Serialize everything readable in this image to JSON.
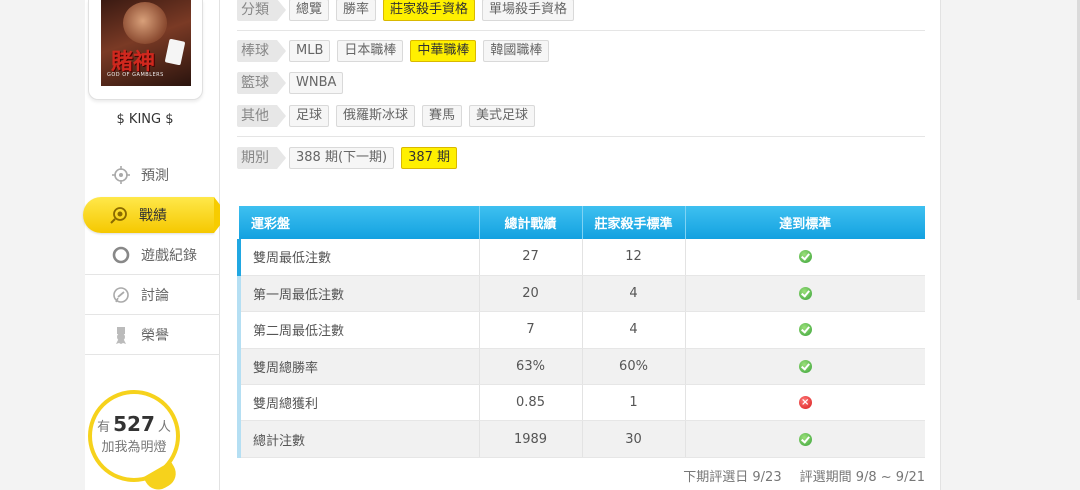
{
  "user": {
    "avatar_title": "賭神",
    "avatar_subtitle": "GOD OF GAMBLERS",
    "name": "$ KING $"
  },
  "nav": [
    {
      "label": "預測",
      "icon": "crosshair-icon",
      "active": false
    },
    {
      "label": "戰績",
      "icon": "chart-icon",
      "active": true
    },
    {
      "label": "遊戲紀錄",
      "icon": "record-icon",
      "active": false
    },
    {
      "label": "討論",
      "icon": "chat-icon",
      "active": false
    },
    {
      "label": "榮譽",
      "icon": "medal-icon",
      "active": false
    }
  ],
  "fans": {
    "prefix": "有",
    "count": "527",
    "suffix": "人",
    "caption": "加我為明燈"
  },
  "filters": {
    "category": {
      "label": "分類",
      "options": [
        "總覽",
        "勝率",
        "莊家殺手資格",
        "單場殺手資格"
      ],
      "selected": "莊家殺手資格"
    },
    "baseball": {
      "label": "棒球",
      "options": [
        "MLB",
        "日本職棒",
        "中華職棒",
        "韓國職棒"
      ],
      "selected": "中華職棒"
    },
    "basketball": {
      "label": "籃球",
      "options": [
        "WNBA"
      ],
      "selected": ""
    },
    "other": {
      "label": "其他",
      "options": [
        "足球",
        "俄羅斯冰球",
        "賽馬",
        "美式足球"
      ],
      "selected": ""
    },
    "period": {
      "label": "期別",
      "options": [
        "388 期(下一期)",
        "387 期"
      ],
      "selected": "387 期"
    }
  },
  "table": {
    "headers": [
      "運彩盤",
      "總計戰績",
      "莊家殺手標準",
      "達到標準"
    ],
    "rows": [
      {
        "name": "雙周最低注數",
        "total": "27",
        "standard": "12",
        "passed": true
      },
      {
        "name": "第一周最低注數",
        "total": "20",
        "standard": "4",
        "passed": true
      },
      {
        "name": "第二周最低注數",
        "total": "7",
        "standard": "4",
        "passed": true
      },
      {
        "name": "雙周總勝率",
        "total": "63%",
        "standard": "60%",
        "passed": true
      },
      {
        "name": "雙周總獲利",
        "total": "0.85",
        "standard": "1",
        "passed": false
      },
      {
        "name": "總計注數",
        "total": "1989",
        "standard": "30",
        "passed": true
      }
    ]
  },
  "footer": {
    "next_review": "下期評選日 9/23",
    "review_period": "評選期間 9/8 ~ 9/21"
  },
  "colors": {
    "accent_yellow": "#fff000",
    "header_blue": "#13a1e0",
    "ok_green": "#3aa23a",
    "fail_red": "#d81c1c"
  }
}
